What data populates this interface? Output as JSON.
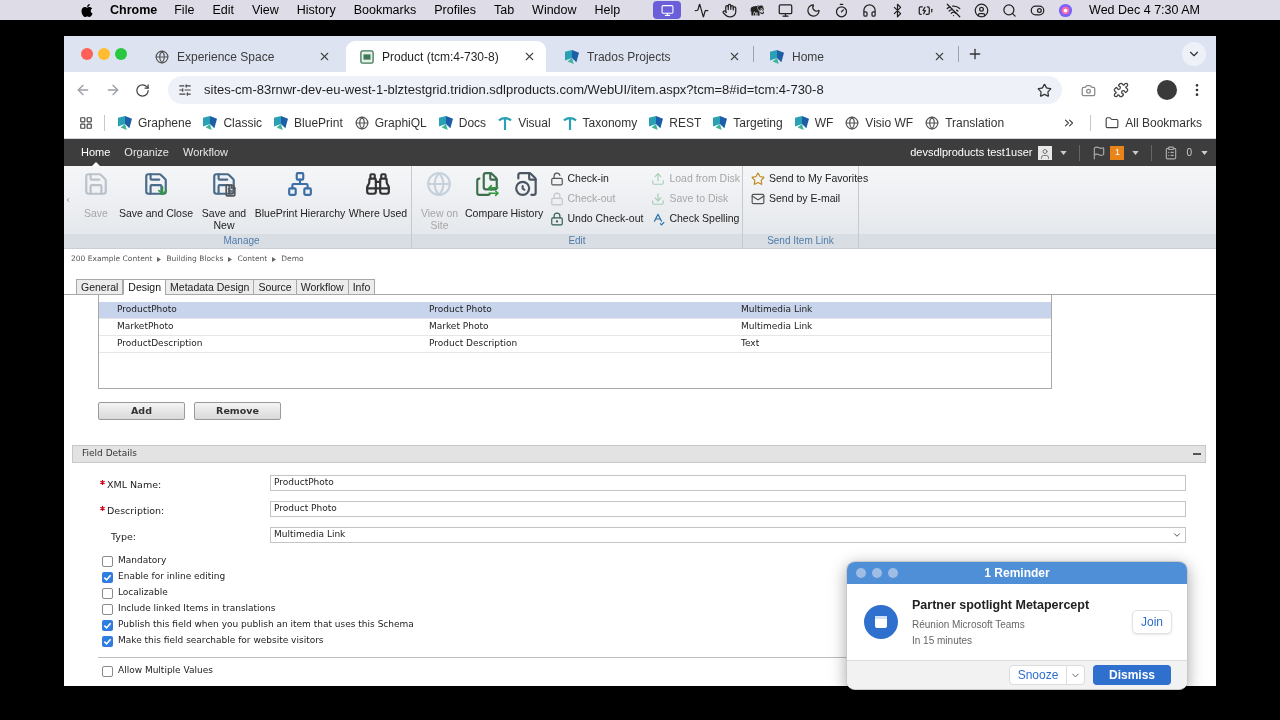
{
  "menu_bar": {
    "app_name": "Chrome",
    "menus": [
      "File",
      "Edit",
      "View",
      "History",
      "Bookmarks",
      "Profiles",
      "Tab",
      "Window",
      "Help"
    ],
    "clock": "Wed Dec 4 7:30 AM"
  },
  "browser": {
    "tabs": [
      {
        "title": "Experience Space",
        "kind": "globe",
        "selected": false
      },
      {
        "title": "Product (tcm:4-730-8)",
        "kind": "page",
        "selected": true
      },
      {
        "title": "Trados Projects",
        "kind": "logo",
        "selected": false
      },
      {
        "title": "Home",
        "kind": "logo",
        "selected": false
      }
    ],
    "url": "sites-cm-83rnwr-dev-eu-west-1-blztestgrid.tridion.sdlproducts.com/WebUI/item.aspx?tcm=8#id=tcm:4-730-8",
    "bookmarks": [
      {
        "label": "Graphene",
        "kind": "logo"
      },
      {
        "label": "Classic",
        "kind": "logo"
      },
      {
        "label": "BluePrint",
        "kind": "logo"
      },
      {
        "label": "GraphiQL",
        "kind": "globe"
      },
      {
        "label": "Docs",
        "kind": "logo"
      },
      {
        "label": "Visual",
        "kind": "pick"
      },
      {
        "label": "Taxonomy",
        "kind": "pick"
      },
      {
        "label": "REST",
        "kind": "logo"
      },
      {
        "label": "Targeting",
        "kind": "logo"
      },
      {
        "label": "WF",
        "kind": "logo"
      },
      {
        "label": "Visio WF",
        "kind": "globe"
      },
      {
        "label": "Translation",
        "kind": "globe"
      }
    ],
    "all_bookmarks": "All Bookmarks"
  },
  "app": {
    "nav": [
      {
        "label": "Home",
        "selected": true
      },
      {
        "label": "Organize",
        "selected": false
      },
      {
        "label": "Workflow",
        "selected": false
      }
    ],
    "user": "devsdlproducts test1user",
    "notifications": "1",
    "tasks": "0"
  },
  "ribbon": {
    "groups": [
      {
        "label": "Manage",
        "items": [
          {
            "label": "Save",
            "kind": "large",
            "disabled": true
          },
          {
            "label": "Save and Close",
            "kind": "large",
            "disabled": false
          },
          {
            "label": "Save and New",
            "kind": "large",
            "disabled": false
          },
          {
            "label": "BluePrint Hierarchy",
            "kind": "large",
            "disabled": false
          },
          {
            "label": "Where Used",
            "kind": "large",
            "disabled": false
          }
        ]
      },
      {
        "label": "Edit",
        "items": [
          {
            "label": "View on Site",
            "kind": "large",
            "disabled": true
          },
          {
            "label": "Compare",
            "kind": "large",
            "disabled": false
          },
          {
            "label": "History",
            "kind": "large",
            "disabled": false
          },
          {
            "label": "Check-in",
            "kind": "small",
            "disabled": false
          },
          {
            "label": "Check-out",
            "kind": "small",
            "disabled": true
          },
          {
            "label": "Undo Check-out",
            "kind": "small",
            "disabled": false
          },
          {
            "label": "Load from Disk",
            "kind": "small",
            "disabled": true
          },
          {
            "label": "Save to Disk",
            "kind": "small",
            "disabled": true
          },
          {
            "label": "Check Spelling",
            "kind": "small",
            "disabled": false
          }
        ]
      },
      {
        "label": "Send Item Link",
        "items": [
          {
            "label": "Send to My Favorites",
            "kind": "small",
            "disabled": false
          },
          {
            "label": "Send by E-mail",
            "kind": "small",
            "disabled": false
          }
        ]
      }
    ]
  },
  "breadcrumb": [
    "200 Example Content",
    "Building Blocks",
    "Content",
    "Demo"
  ],
  "item_tabs": [
    {
      "label": "General",
      "selected": false
    },
    {
      "label": "Design",
      "selected": true
    },
    {
      "label": "Metadata Design",
      "selected": false
    },
    {
      "label": "Source",
      "selected": false
    },
    {
      "label": "Workflow",
      "selected": false
    },
    {
      "label": "Info",
      "selected": false
    }
  ],
  "fields_table": {
    "rows": [
      {
        "cells": [
          "ProductPhoto",
          "Product Photo",
          "Multimedia Link"
        ],
        "selected": true
      },
      {
        "cells": [
          "MarketPhoto",
          "Market Photo",
          "Multimedia Link"
        ],
        "selected": false
      },
      {
        "cells": [
          "ProductDescription",
          "Product Description",
          "Text"
        ],
        "selected": false
      }
    ]
  },
  "table_buttons": [
    "Add",
    "Remove"
  ],
  "field_details": {
    "title": "Field Details",
    "fields": [
      {
        "label": "XML Name:",
        "required": true,
        "kind": "text",
        "value": "ProductPhoto"
      },
      {
        "label": "Description:",
        "required": true,
        "kind": "text",
        "value": "Product Photo"
      },
      {
        "label": "Type:",
        "required": false,
        "kind": "select",
        "value": "Multimedia Link"
      }
    ],
    "options": [
      {
        "label": "Mandatory",
        "checked": false
      },
      {
        "label": "Enable for inline editing",
        "checked": true
      },
      {
        "label": "Localizable",
        "checked": false
      },
      {
        "label": "Include linked Items in translations",
        "checked": false
      },
      {
        "label": "Publish this field when you publish an item that uses this Schema",
        "checked": true
      },
      {
        "label": "Make this field searchable for website visitors",
        "checked": true
      }
    ],
    "more_options": [
      {
        "label": "Allow Multiple Values",
        "checked": false
      }
    ]
  },
  "reminder": {
    "title": "1 Reminder",
    "event": "Partner spotlight Metapercept",
    "location": "Réunion Microsoft Teams",
    "time": "In 15 minutes",
    "join": "Join",
    "snooze": "Snooze",
    "dismiss": "Dismiss"
  }
}
